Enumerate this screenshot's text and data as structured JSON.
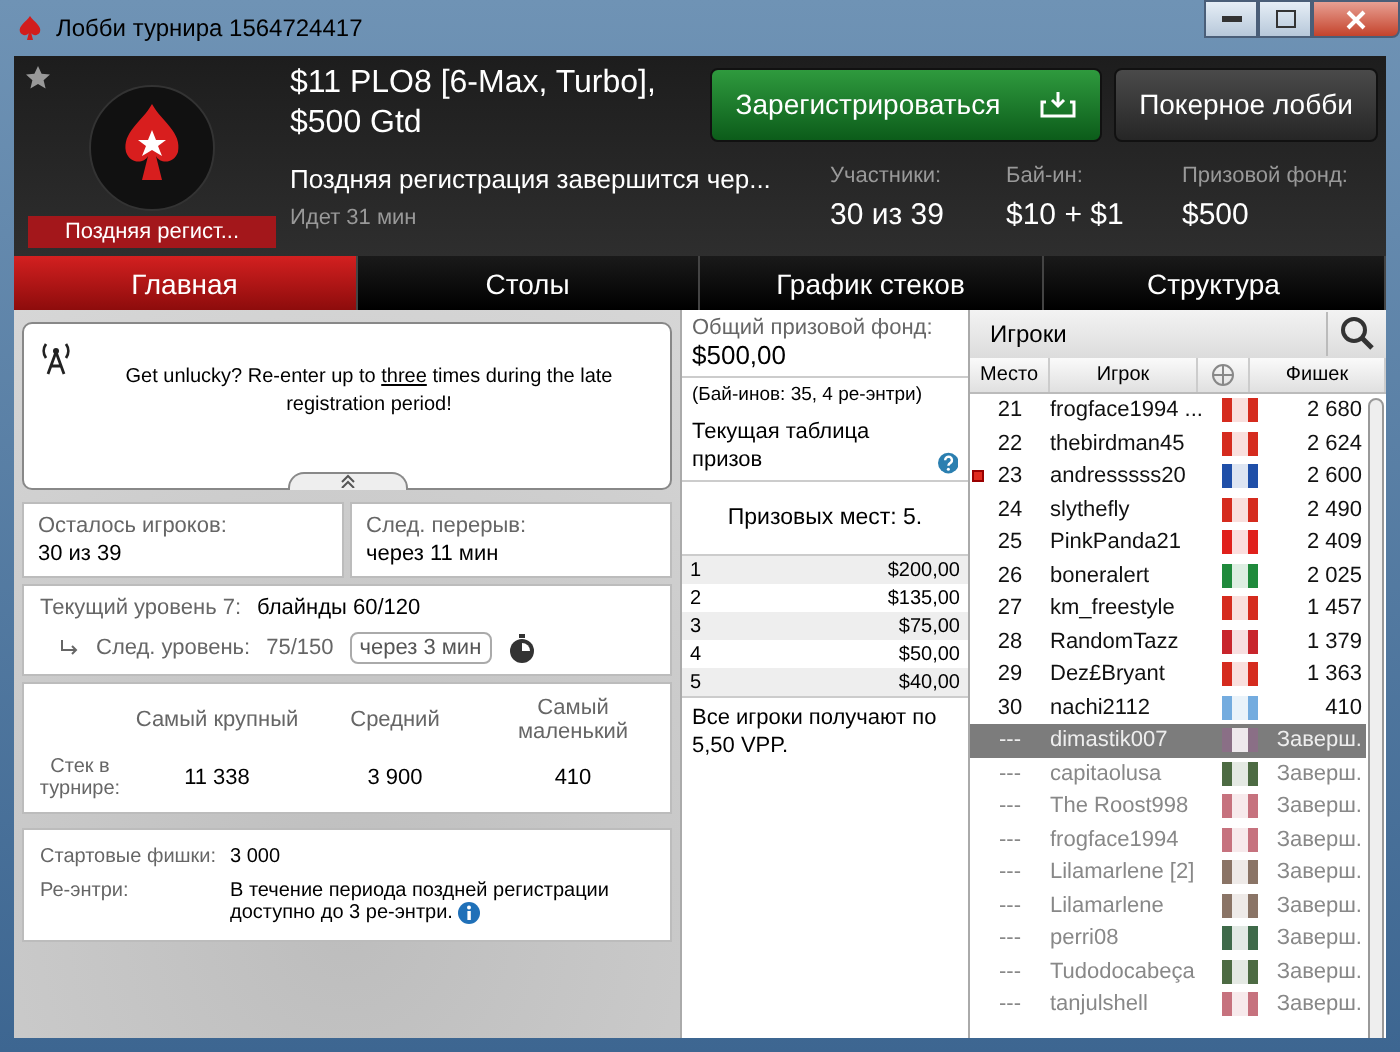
{
  "window": {
    "title": "Лобби турнира 1564724417"
  },
  "header": {
    "tournament": "$11 PLO8 [6-Max, Turbo],",
    "guarantee": "$500 Gtd",
    "status_badge": "Поздняя регист...",
    "late_reg": "Поздняя регистрация завершится чер...",
    "running": "Идет 31 мин",
    "register_button": "Зарегистрироваться",
    "lobby_button": "Покерное лобби",
    "favorite": false,
    "stats": [
      {
        "label": "Участники:",
        "value": "30 из 39"
      },
      {
        "label": "Бай-ин:",
        "value": "$10 + $1"
      },
      {
        "label": "Призовой фонд:",
        "value": "$500"
      }
    ]
  },
  "tabs": [
    {
      "label": "Главная",
      "selected": true
    },
    {
      "label": "Столы",
      "selected": false
    },
    {
      "label": "График стеков",
      "selected": false
    },
    {
      "label": "Структура",
      "selected": false
    }
  ],
  "notice": {
    "before": "Get unlucky? Re-enter up to",
    "underlined": "three",
    "after": "times during the late registration period!"
  },
  "remaining": {
    "label": "Осталось игроков:",
    "value": "30 из 39"
  },
  "next_break": {
    "label": "След. перерыв:",
    "value": "через 11 мин"
  },
  "level": {
    "label": "Текущий уровень 7:",
    "value": "блайнды 60/120",
    "next_label": "След. уровень:",
    "next_value": "75/150",
    "next_time": "через 3 мин"
  },
  "stacks": {
    "label": "Стек в турнире:",
    "columns": [
      {
        "label": "Самый крупный",
        "value": "11 338"
      },
      {
        "label": "Средний",
        "value": "3 900"
      },
      {
        "label": "Самый маленький",
        "value": "410"
      }
    ]
  },
  "info": [
    {
      "label": "Стартовые фишки:",
      "value": "3 000",
      "info": false
    },
    {
      "label": "Ре-энтри:",
      "value": "В течение периода поздней регистрации доступно до 3 ре-энтри.",
      "info": true
    }
  ],
  "prizes": {
    "pool_label": "Общий призовой фонд:",
    "pool": "$500,00",
    "buyins": "(Бай-инов: 35, 4 ре-энтри)",
    "table_title": "Текущая таблица призов",
    "places": "Призовых мест: 5.",
    "rows": [
      {
        "place": "1",
        "amount": "$200,00"
      },
      {
        "place": "2",
        "amount": "$135,00"
      },
      {
        "place": "3",
        "amount": "$75,00"
      },
      {
        "place": "4",
        "amount": "$50,00"
      },
      {
        "place": "5",
        "amount": "$40,00"
      }
    ],
    "vpp": "Все игроки получают по 5,50 VPP."
  },
  "players": {
    "title": "Игроки",
    "columns": [
      "Место",
      "Игрок",
      "Фишек"
    ],
    "rows": [
      {
        "place": "21",
        "name": "frogface1994 ...",
        "chips": "2 680",
        "color": "#d52b1e",
        "flagged": false,
        "finished": false,
        "selected": false
      },
      {
        "place": "22",
        "name": "thebirdman45",
        "chips": "2 624",
        "color": "#d52b1e",
        "flagged": false,
        "finished": false,
        "selected": false
      },
      {
        "place": "23",
        "name": "andresssss20",
        "chips": "2 600",
        "color": "#1f4fa8",
        "flagged": true,
        "finished": false,
        "selected": false
      },
      {
        "place": "24",
        "name": "slythefly",
        "chips": "2 490",
        "color": "#d52b1e",
        "flagged": false,
        "finished": false,
        "selected": false
      },
      {
        "place": "25",
        "name": "PinkPanda21",
        "chips": "2 409",
        "color": "#e0201c",
        "flagged": false,
        "finished": false,
        "selected": false
      },
      {
        "place": "26",
        "name": "boneralert",
        "chips": "2 025",
        "color": "#1f8a3c",
        "flagged": false,
        "finished": false,
        "selected": false
      },
      {
        "place": "27",
        "name": "km_freestyle",
        "chips": "1 457",
        "color": "#d52b1e",
        "flagged": false,
        "finished": false,
        "selected": false
      },
      {
        "place": "28",
        "name": "RandomTazz",
        "chips": "1 379",
        "color": "#c8252c",
        "flagged": false,
        "finished": false,
        "selected": false
      },
      {
        "place": "29",
        "name": "Dez£Bryant",
        "chips": "1 363",
        "color": "#d52b1e",
        "flagged": false,
        "finished": false,
        "selected": false
      },
      {
        "place": "30",
        "name": "nachi2112",
        "chips": "410",
        "color": "#74acdf",
        "flagged": false,
        "finished": false,
        "selected": false
      },
      {
        "place": "---",
        "name": "dimastik007",
        "chips": "Заверш.",
        "color": "#8a6f86",
        "flagged": false,
        "finished": true,
        "selected": true
      },
      {
        "place": "---",
        "name": "capitaolusa",
        "chips": "Заверш.",
        "color": "#4d6b43",
        "flagged": false,
        "finished": true,
        "selected": false
      },
      {
        "place": "---",
        "name": "The Roost998",
        "chips": "Заверш.",
        "color": "#c6727e",
        "flagged": false,
        "finished": true,
        "selected": false
      },
      {
        "place": "---",
        "name": "frogface1994",
        "chips": "Заверш.",
        "color": "#c6727e",
        "flagged": false,
        "finished": true,
        "selected": false
      },
      {
        "place": "---",
        "name": "Lilamarlene [2]",
        "chips": "Заверш.",
        "color": "#8a7466",
        "flagged": false,
        "finished": true,
        "selected": false
      },
      {
        "place": "---",
        "name": "Lilamarlene",
        "chips": "Заверш.",
        "color": "#8a7466",
        "flagged": false,
        "finished": true,
        "selected": false
      },
      {
        "place": "---",
        "name": "perri08",
        "chips": "Заверш.",
        "color": "#3f6a4a",
        "flagged": false,
        "finished": true,
        "selected": false
      },
      {
        "place": "---",
        "name": "Tudodocabeça",
        "chips": "Заверш.",
        "color": "#4d6b43",
        "flagged": false,
        "finished": true,
        "selected": false
      },
      {
        "place": "---",
        "name": "tanjulshell",
        "chips": "Заверш.",
        "color": "#c6727e",
        "flagged": false,
        "finished": true,
        "selected": false
      }
    ]
  }
}
